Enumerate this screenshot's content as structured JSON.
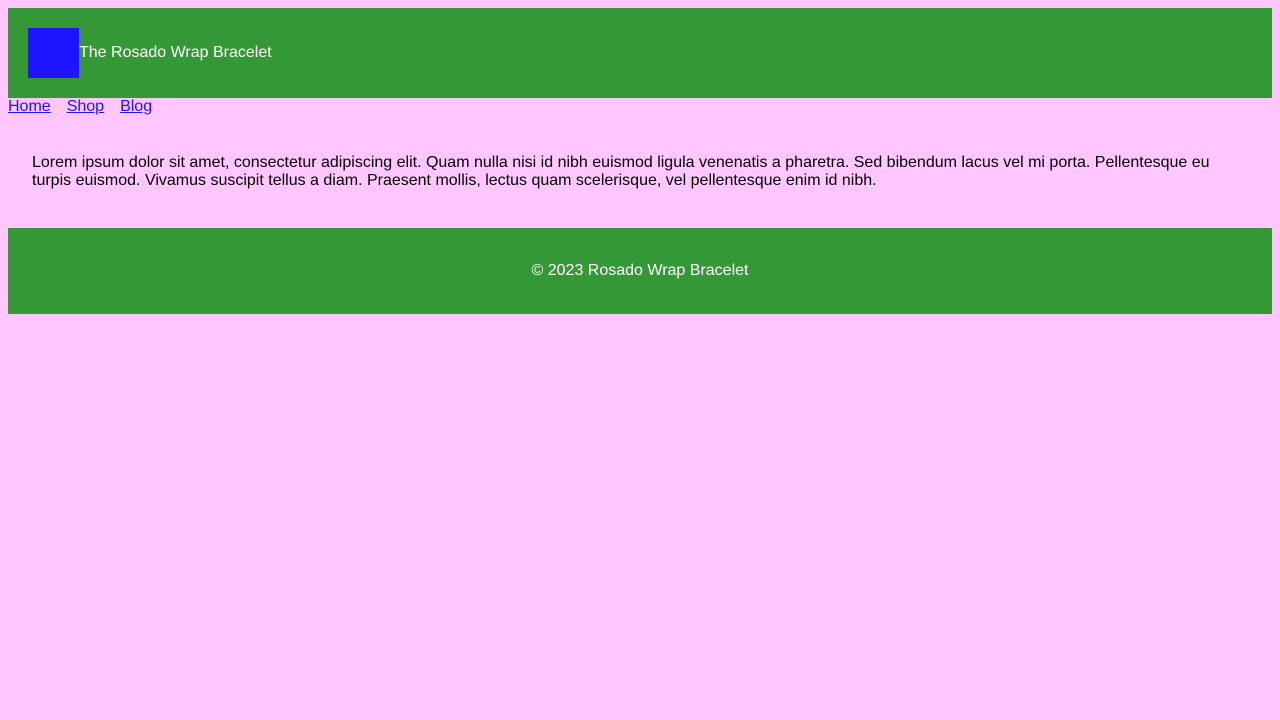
{
  "header": {
    "title": "The Rosado Wrap Bracelet",
    "logo_color": "#1f14ff",
    "background_color": "#359836"
  },
  "nav": {
    "items": [
      {
        "label": "Home"
      },
      {
        "label": "Shop"
      },
      {
        "label": "Blog"
      }
    ],
    "link_color": "#1f14ff"
  },
  "main": {
    "paragraph": "Lorem ipsum dolor sit amet, consectetur adipiscing elit. Quam nulla nisi id nibh euismod ligula venenatis a pharetra. Sed bibendum lacus vel mi porta. Pellentesque eu turpis euismod. Vivamus suscipit tellus a diam. Praesent mollis, lectus quam scelerisque, vel pellentesque enim id nibh."
  },
  "footer": {
    "text": "© 2023 Rosado Wrap Bracelet",
    "background_color": "#359836"
  },
  "page": {
    "background_color": "#ffc6ff"
  }
}
